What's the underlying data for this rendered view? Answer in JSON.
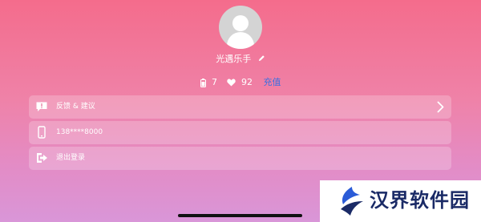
{
  "profile": {
    "username": "光遇乐手",
    "battery_count": "7",
    "likes_count": "92",
    "recharge_label": "充值"
  },
  "menu": {
    "items": [
      {
        "label": "反馈 & 建议",
        "icon": "feedback-icon",
        "has_chevron": true
      },
      {
        "label": "138****8000",
        "icon": "phone-icon",
        "has_chevron": false
      },
      {
        "label": "退出登录",
        "icon": "logout-icon",
        "has_chevron": false
      }
    ]
  },
  "watermark": {
    "text": "汉界软件园"
  },
  "colors": {
    "gradient_top": "#f46c8c",
    "gradient_bottom": "#d996d8",
    "recharge_link": "#3d6fe0",
    "watermark_text": "#1a2a66"
  }
}
